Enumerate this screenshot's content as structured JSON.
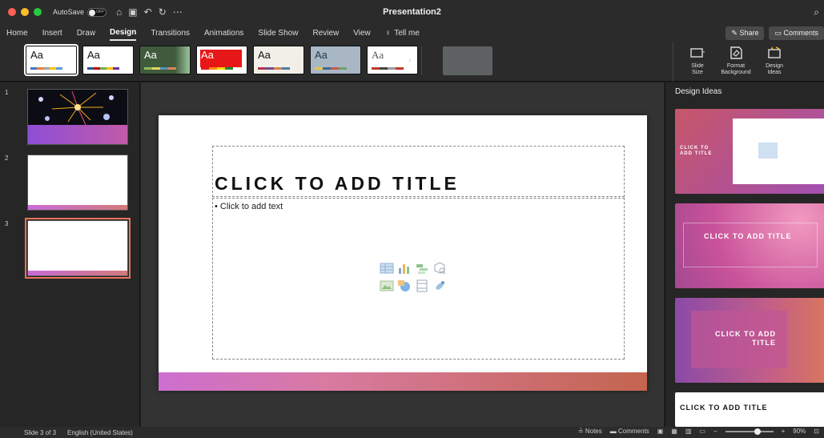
{
  "titlebar": {
    "autosave_label": "AutoSave",
    "autosave_state": "OFF",
    "document_title": "Presentation2",
    "colors": {
      "close": "#ff5f57",
      "minimize": "#febc2e",
      "zoom": "#28c840"
    }
  },
  "tabs": [
    {
      "label": "Home",
      "active": false
    },
    {
      "label": "Insert",
      "active": false
    },
    {
      "label": "Draw",
      "active": false
    },
    {
      "label": "Design",
      "active": true
    },
    {
      "label": "Transitions",
      "active": false
    },
    {
      "label": "Animations",
      "active": false
    },
    {
      "label": "Slide Show",
      "active": false
    },
    {
      "label": "Review",
      "active": false
    },
    {
      "label": "View",
      "active": false
    }
  ],
  "tell_me": "Tell me",
  "share_label": "Share",
  "comments_label": "Comments",
  "themes": [
    {
      "label": "Aa",
      "bg": "#ffffff",
      "fg": "#111111",
      "selected": true
    },
    {
      "label": "Aa",
      "bg": "#ffffff",
      "fg": "#111111",
      "selected": false
    },
    {
      "label": "Aa",
      "bg": "#3f5b3b",
      "fg": "#ffffff",
      "selected": false
    },
    {
      "label": "Aa",
      "bg": "#ffffff",
      "fg": "#ffffff",
      "selected": false
    },
    {
      "label": "Aa",
      "bg": "#f1efe8",
      "fg": "#111111",
      "selected": false
    },
    {
      "label": "Aa",
      "bg": "#a9b7c4",
      "fg": "#1d3a52",
      "selected": false
    },
    {
      "label": "Aa",
      "bg": "#ffffff",
      "fg": "#555555",
      "selected": false
    }
  ],
  "ribbon_tools": [
    {
      "label": "Slide\nSize",
      "icon": "slide-size-icon"
    },
    {
      "label": "Format\nBackground",
      "icon": "format-background-icon"
    },
    {
      "label": "Design\nIdeas",
      "icon": "design-ideas-icon"
    }
  ],
  "slides": [
    {
      "number": "1"
    },
    {
      "number": "2"
    },
    {
      "number": "3"
    }
  ],
  "slide": {
    "title_placeholder": "CLICK TO ADD TITLE",
    "body_placeholder": "Click to add text"
  },
  "design_ideas": {
    "title": "Design Ideas",
    "items": [
      "CLICK TO\nADD TITLE",
      "CLICK TO ADD TITLE",
      "CLICK TO ADD\nTITLE",
      "CLICK TO ADD TITLE"
    ]
  },
  "status": {
    "slide_info": "Slide 3 of 3",
    "language": "English (United States)",
    "notes_label": "Notes",
    "comments_label": "Comments",
    "zoom": "90%"
  }
}
